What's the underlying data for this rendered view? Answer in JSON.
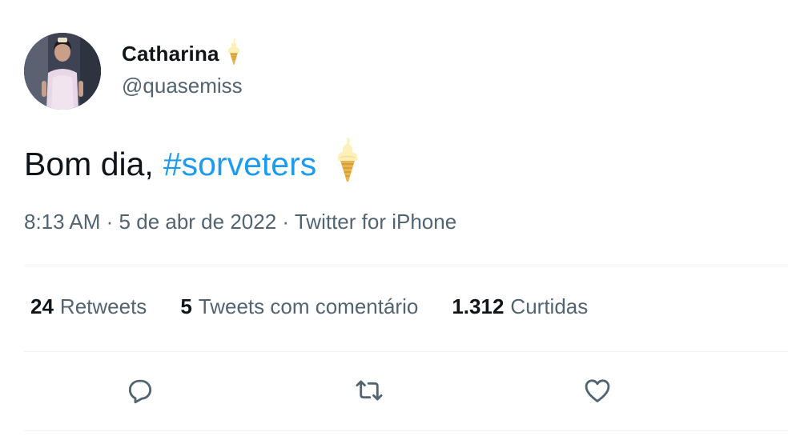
{
  "author": {
    "display_name": "Catharina",
    "handle": "@quasemiss",
    "name_emoji_icon": "soft-ice-cream-icon"
  },
  "tweet": {
    "text_prefix": "Bom dia,",
    "hashtag": "#sorveters",
    "emoji_icon": "soft-ice-cream-icon"
  },
  "meta": {
    "time": "8:13 AM",
    "separator": "·",
    "date": "5 de abr de 2022",
    "source": "Twitter for iPhone"
  },
  "stats": [
    {
      "count": "24",
      "label": "Retweets"
    },
    {
      "count": "5",
      "label": "Tweets com comentário"
    },
    {
      "count": "1.312",
      "label": "Curtidas"
    }
  ],
  "actions": [
    {
      "name": "reply",
      "icon": "reply-icon"
    },
    {
      "name": "retweet",
      "icon": "retweet-icon"
    },
    {
      "name": "like",
      "icon": "heart-icon"
    }
  ],
  "colors": {
    "text": "#0f1419",
    "secondary": "#536471",
    "link": "#1d9bf0",
    "divider": "#eff3f4",
    "icon": "#536471"
  }
}
